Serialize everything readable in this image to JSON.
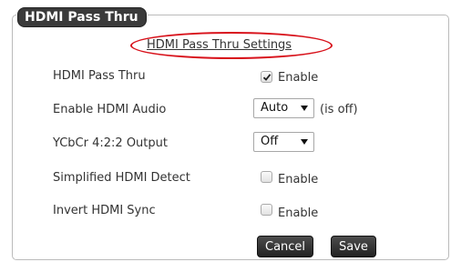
{
  "legend": "HDMI Pass Thru",
  "section_title": "HDMI Pass Thru Settings",
  "rows": {
    "pass_thru": {
      "label": "HDMI Pass Thru",
      "checkbox_label": "Enable",
      "checked": true
    },
    "audio": {
      "label": "Enable HDMI Audio",
      "select_value": "Auto",
      "hint": "(is off)"
    },
    "ycbcr": {
      "label": "YCbCr 4:2:2 Output",
      "select_value": "Off"
    },
    "simplified_detect": {
      "label": "Simplified HDMI Detect",
      "checkbox_label": "Enable",
      "checked": false
    },
    "invert_sync": {
      "label": "Invert HDMI Sync",
      "checkbox_label": "Enable",
      "checked": false
    }
  },
  "buttons": {
    "cancel": "Cancel",
    "save": "Save"
  },
  "colors": {
    "highlight": "#d8121b",
    "button": "#2e2e2e",
    "legend": "#3a3a3a"
  }
}
